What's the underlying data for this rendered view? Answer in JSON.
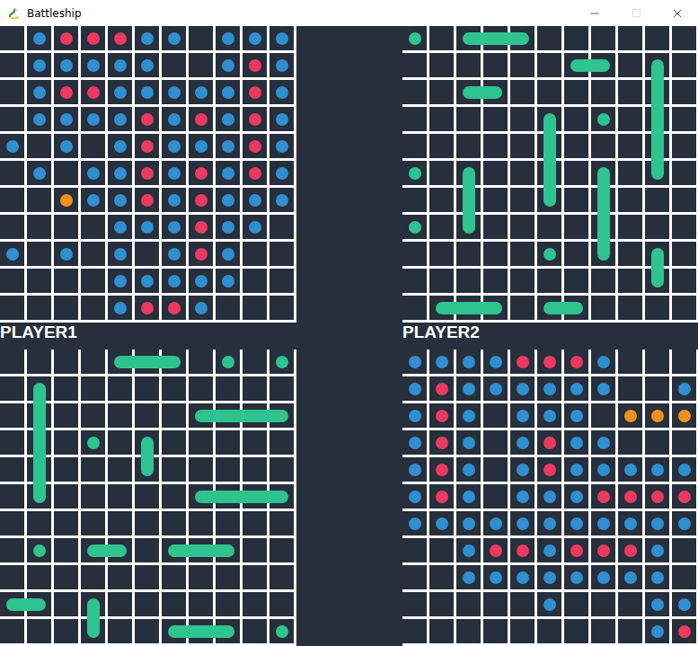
{
  "window": {
    "title": "Battleship"
  },
  "markerColors": {
    "B": "#2f8fd0",
    "R": "#ea3a62",
    "O": "#f2901c",
    "ship": "#2fc38f"
  },
  "labels": [
    {
      "text": "PLAYER1"
    },
    {
      "text": "PLAYER2"
    }
  ],
  "boards": [
    {
      "name": "player1-shots",
      "rows": [
        ".BRRRBB.BBB",
        ".BBBBB..BRB",
        ".BRRBBBBBRB",
        ".BBBBRBRBRB",
        "B.B.BRBBBRB",
        ".B.BBRBRBRB",
        "..OBBRBRBBB",
        "....BBBRBB.",
        "B.B.B.BRB..",
        "....BBBBB..",
        "....BRRB..."
      ],
      "ships": []
    },
    {
      "name": "player2-fleet",
      "rows": [
        "...........",
        "...........",
        "...........",
        "...........",
        "...........",
        "...........",
        "...........",
        "...........",
        "...........",
        "...........",
        "..........."
      ],
      "ships": [
        {
          "row": 0,
          "col": 0,
          "length": 1,
          "vertical": false
        },
        {
          "row": 0,
          "col": 2,
          "length": 3,
          "vertical": false
        },
        {
          "row": 1,
          "col": 6,
          "length": 2,
          "vertical": false
        },
        {
          "row": 1,
          "col": 9,
          "length": 5,
          "vertical": true
        },
        {
          "row": 2,
          "col": 2,
          "length": 2,
          "vertical": false
        },
        {
          "row": 3,
          "col": 5,
          "length": 4,
          "vertical": true
        },
        {
          "row": 3,
          "col": 7,
          "length": 1,
          "vertical": false
        },
        {
          "row": 5,
          "col": 0,
          "length": 1,
          "vertical": false
        },
        {
          "row": 5,
          "col": 2,
          "length": 3,
          "vertical": true
        },
        {
          "row": 5,
          "col": 7,
          "length": 4,
          "vertical": true
        },
        {
          "row": 7,
          "col": 0,
          "length": 1,
          "vertical": false
        },
        {
          "row": 8,
          "col": 5,
          "length": 1,
          "vertical": false
        },
        {
          "row": 8,
          "col": 9,
          "length": 2,
          "vertical": true
        },
        {
          "row": 10,
          "col": 1,
          "length": 3,
          "vertical": false
        },
        {
          "row": 10,
          "col": 5,
          "length": 2,
          "vertical": false
        }
      ]
    },
    {
      "name": "player1-fleet",
      "rows": [
        "...........",
        "...........",
        "...........",
        "...........",
        "...........",
        "...........",
        "...........",
        "...........",
        "...........",
        "...........",
        "..........."
      ],
      "ships": [
        {
          "row": 0,
          "col": 4,
          "length": 3,
          "vertical": false
        },
        {
          "row": 0,
          "col": 8,
          "length": 1,
          "vertical": false
        },
        {
          "row": 0,
          "col": 10,
          "length": 1,
          "vertical": false
        },
        {
          "row": 1,
          "col": 1,
          "length": 5,
          "vertical": true
        },
        {
          "row": 2,
          "col": 7,
          "length": 4,
          "vertical": false
        },
        {
          "row": 3,
          "col": 3,
          "length": 1,
          "vertical": false
        },
        {
          "row": 3,
          "col": 5,
          "length": 2,
          "vertical": true
        },
        {
          "row": 5,
          "col": 7,
          "length": 4,
          "vertical": false
        },
        {
          "row": 7,
          "col": 1,
          "length": 1,
          "vertical": false
        },
        {
          "row": 7,
          "col": 3,
          "length": 2,
          "vertical": false
        },
        {
          "row": 7,
          "col": 6,
          "length": 3,
          "vertical": false
        },
        {
          "row": 9,
          "col": 0,
          "length": 2,
          "vertical": false
        },
        {
          "row": 9,
          "col": 3,
          "length": 2,
          "vertical": true
        },
        {
          "row": 10,
          "col": 6,
          "length": 3,
          "vertical": false
        },
        {
          "row": 10,
          "col": 10,
          "length": 1,
          "vertical": false
        }
      ]
    },
    {
      "name": "player2-shots",
      "rows": [
        "BBBBRRRB...",
        "BRBBBBBB..B",
        "BRB.BBB.OOO",
        "BRB.BRBB...",
        "BRB.BRBBBBB",
        "BRB.BBBRRRR",
        "BBBBBBBBBBB",
        "..BRRBRRRB.",
        "..BBBBBBBB.",
        ".....B...BB",
        ".........BR"
      ],
      "ships": []
    }
  ]
}
